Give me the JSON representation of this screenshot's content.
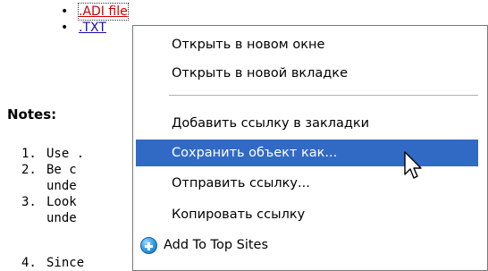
{
  "links": [
    {
      "bullet": "•",
      "text": ".ADI file"
    },
    {
      "bullet": "•",
      "text": ".TXT"
    }
  ],
  "notes": {
    "heading": "Notes:",
    "items": [
      {
        "num": "1.",
        "lines": [
          "Use ."
        ]
      },
      {
        "num": "2.",
        "lines": [
          "Be c",
          "unde"
        ]
      },
      {
        "num": "3.",
        "lines": [
          "Look",
          "unde"
        ]
      },
      {
        "num": "4.",
        "lines": [
          "Since"
        ]
      }
    ]
  },
  "context_menu": {
    "items": [
      {
        "label": "Открыть в новом окне"
      },
      {
        "label": "Открыть в новой вкладке"
      },
      {
        "label": "Добавить ссылку в закладки"
      },
      {
        "label": "Сохранить объект как..."
      },
      {
        "label": "Отправить ссылку..."
      },
      {
        "label": "Копировать ссылку"
      },
      {
        "label": "Add To Top Sites",
        "icon": "plus-circle-icon"
      }
    ],
    "highlighted_index": 3,
    "highlight_color": "#316ac5"
  },
  "colors": {
    "link": "#1a0dab",
    "visited_link": "#cc0000"
  }
}
